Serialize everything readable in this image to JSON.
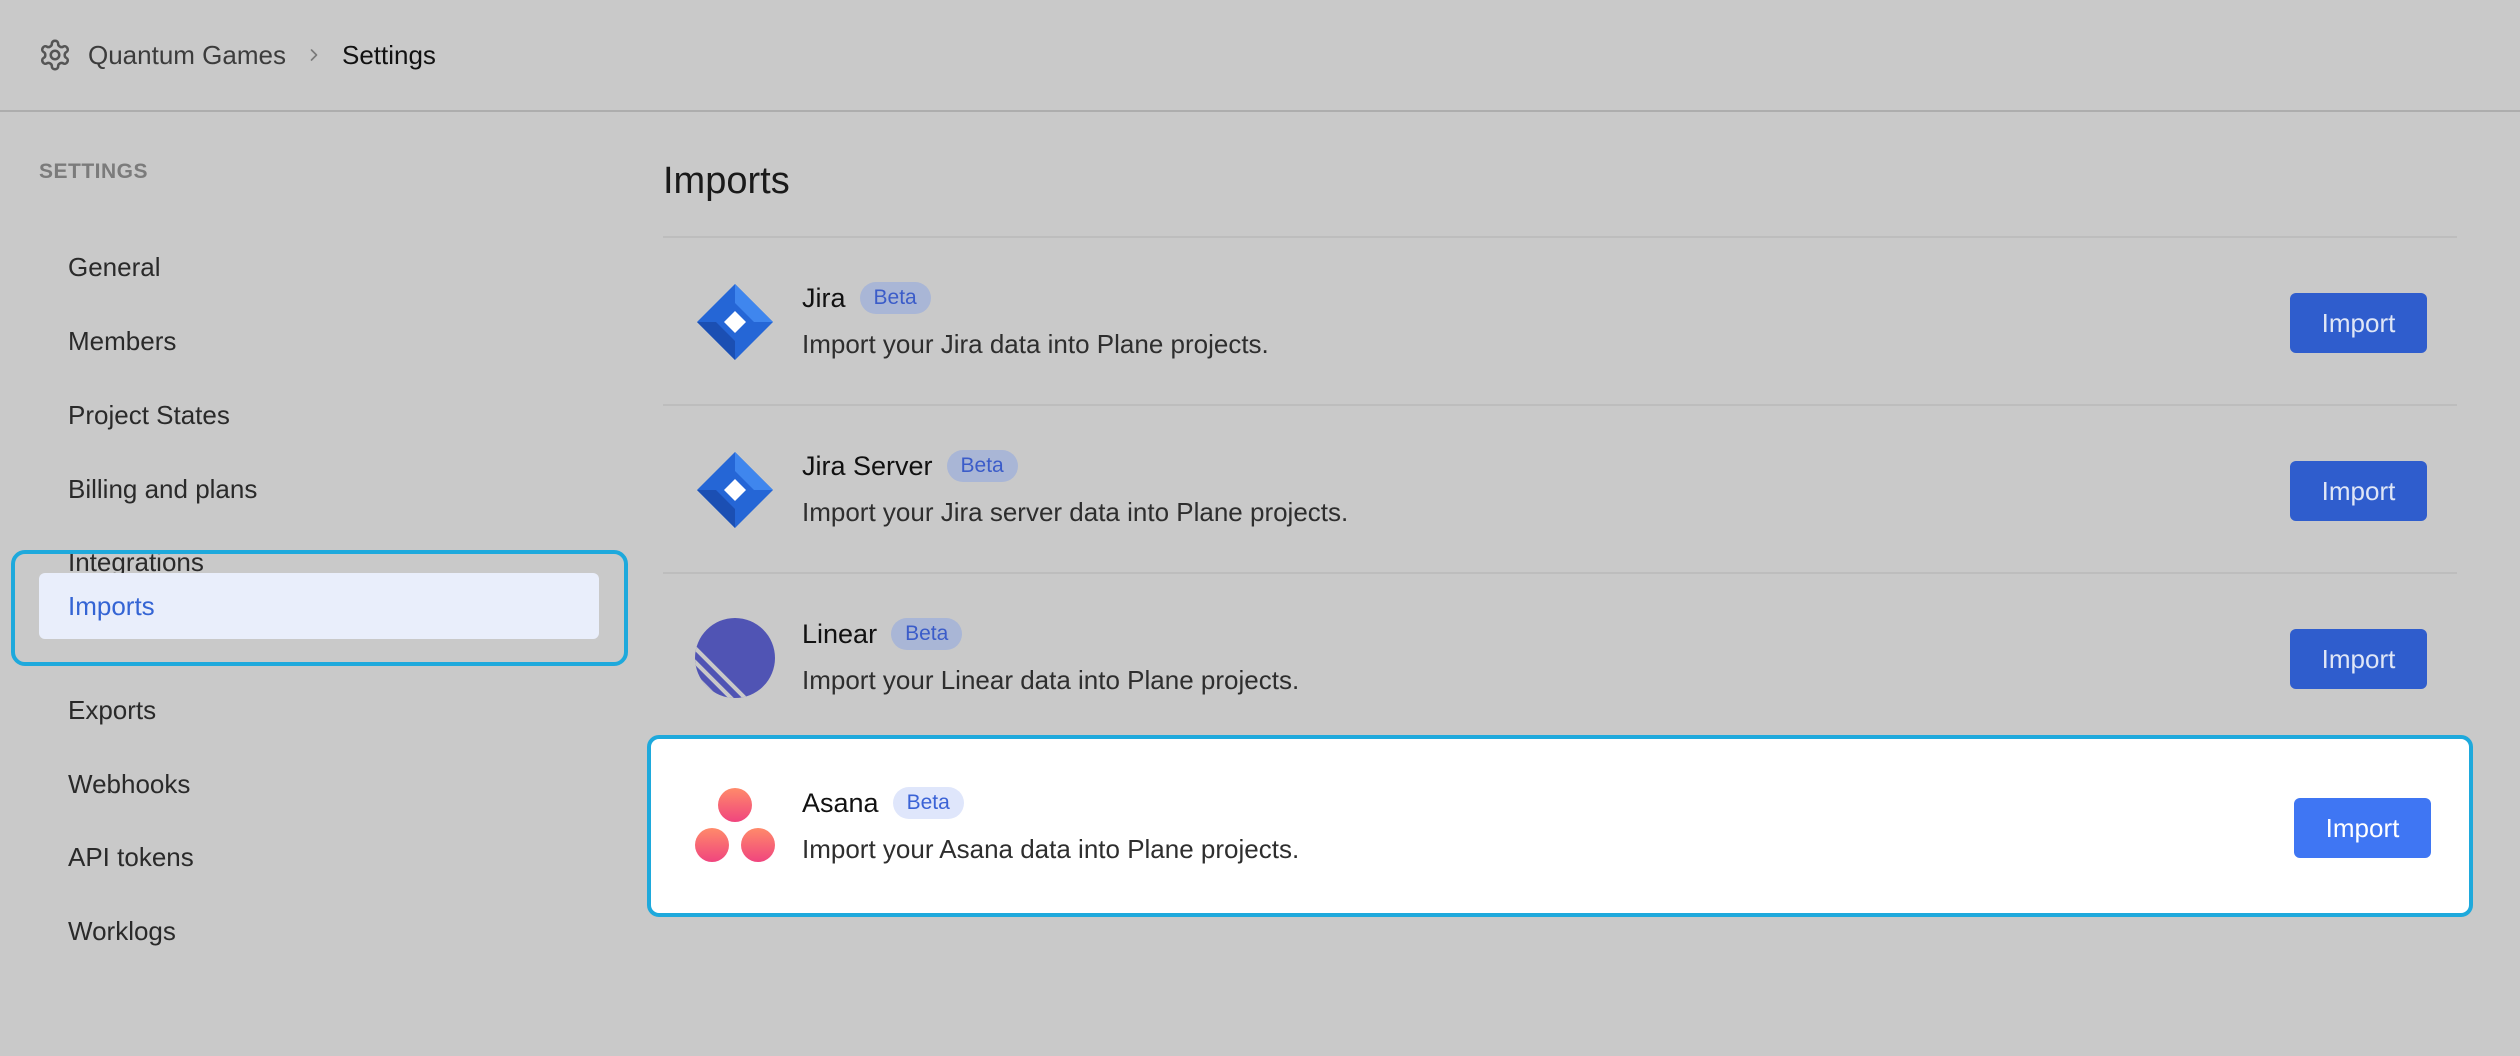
{
  "breadcrumb": {
    "icon": "gear-icon",
    "workspace": "Quantum Games",
    "separator_icon": "chevron-right-icon",
    "current": "Settings"
  },
  "sidebar": {
    "heading": "SETTINGS",
    "items": [
      {
        "label": "General"
      },
      {
        "label": "Members"
      },
      {
        "label": "Project States"
      },
      {
        "label": "Billing and plans"
      },
      {
        "label": "Integrations"
      },
      {
        "label": "Imports",
        "active": true
      },
      {
        "label": "Exports"
      },
      {
        "label": "Webhooks"
      },
      {
        "label": "API tokens"
      },
      {
        "label": "Worklogs"
      }
    ]
  },
  "main": {
    "title": "Imports",
    "importers": [
      {
        "name": "Jira",
        "badge": "Beta",
        "description": "Import your Jira data into Plane projects.",
        "button": "Import",
        "icon": "jira-icon"
      },
      {
        "name": "Jira Server",
        "badge": "Beta",
        "description": "Import your Jira server data into Plane projects.",
        "button": "Import",
        "icon": "jira-icon"
      },
      {
        "name": "Linear",
        "badge": "Beta",
        "description": "Import your Linear data into Plane projects.",
        "button": "Import",
        "icon": "linear-icon"
      },
      {
        "name": "Asana",
        "badge": "Beta",
        "description": "Import your Asana data into Plane projects.",
        "button": "Import",
        "icon": "asana-icon"
      }
    ]
  },
  "colors": {
    "accent": "#3f76f3",
    "highlight": "#1ea9dc",
    "active_nav_bg": "#e9eefb"
  }
}
